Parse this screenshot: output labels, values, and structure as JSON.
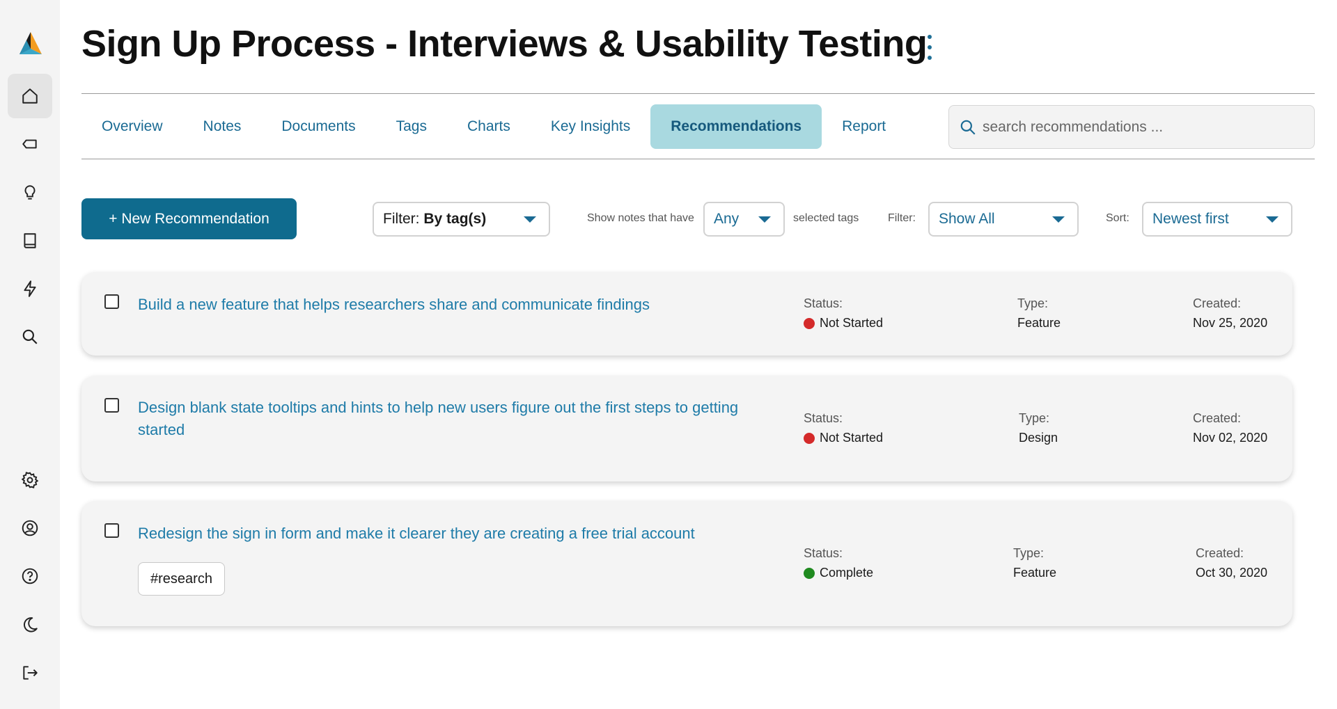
{
  "colors": {
    "accent": "#0f6b8e",
    "link": "#1e7ba8",
    "active_tab": "#a9d9e0",
    "not_started": "#d42a2a",
    "complete": "#1f8a1f"
  },
  "sidebar": {
    "logo": "app-logo",
    "items": [
      {
        "name": "home",
        "icon": "home-icon",
        "active": true
      },
      {
        "name": "tags",
        "icon": "tag-icon"
      },
      {
        "name": "insights",
        "icon": "lightbulb-icon"
      },
      {
        "name": "library",
        "icon": "book-icon"
      },
      {
        "name": "quick-actions",
        "icon": "bolt-icon"
      },
      {
        "name": "search",
        "icon": "search-icon"
      },
      {
        "name": "settings",
        "icon": "gear-icon"
      },
      {
        "name": "account",
        "icon": "user-circle-icon"
      },
      {
        "name": "help",
        "icon": "help-icon"
      },
      {
        "name": "dark-mode",
        "icon": "moon-icon"
      },
      {
        "name": "logout",
        "icon": "logout-icon"
      }
    ]
  },
  "header": {
    "title": "Sign Up Process - Interviews & Usability Testing"
  },
  "tabs": [
    {
      "label": "Overview"
    },
    {
      "label": "Notes"
    },
    {
      "label": "Documents"
    },
    {
      "label": "Tags"
    },
    {
      "label": "Charts"
    },
    {
      "label": "Key Insights"
    },
    {
      "label": "Recommendations",
      "active": true
    },
    {
      "label": "Report"
    }
  ],
  "search": {
    "placeholder": "search recommendations ..."
  },
  "toolbar": {
    "new_button": "+ New Recommendation",
    "tag_filter_prefix": "Filter: ",
    "tag_filter_value": "By tag(s)",
    "show_notes_label": "Show notes that have",
    "match_value": "Any",
    "selected_tags_label": "selected tags",
    "filter_label": "Filter:",
    "filter_value": "Show All",
    "sort_label": "Sort:",
    "sort_value": "Newest first"
  },
  "labels": {
    "status": "Status:",
    "type": "Type:",
    "created": "Created:"
  },
  "recommendations": [
    {
      "title": "Build a new feature that helps researchers share and communicate findings",
      "status": "Not Started",
      "type": "Feature",
      "created": "Nov 25, 2020"
    },
    {
      "title": "Design blank state tooltips and hints to help new users figure out the first steps to getting started",
      "status": "Not Started",
      "type": "Design",
      "created": "Nov 02, 2020"
    },
    {
      "title": "Redesign the sign in form and make it clearer they are creating a free trial account",
      "status": "Complete",
      "type": "Feature",
      "created": "Oct 30, 2020",
      "tags": [
        "#research"
      ]
    }
  ]
}
